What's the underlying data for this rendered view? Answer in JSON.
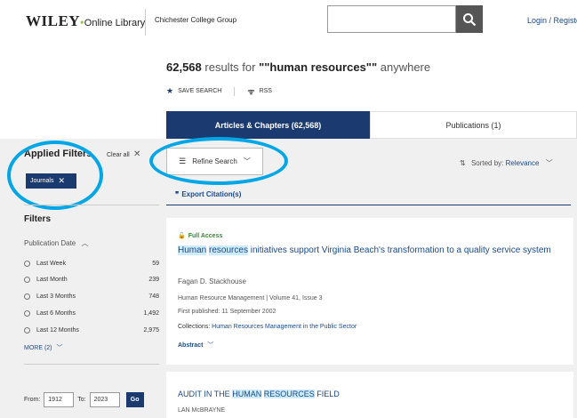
{
  "header": {
    "logo_main": "WILEY",
    "logo_sub": "Online Library",
    "institution": "Chichester College Group",
    "search_placeholder": "",
    "login": "Login / Registe"
  },
  "results": {
    "count": "62,568",
    "results_for": "results for",
    "query": "\"\"human resources\"\"",
    "scope": "anywhere",
    "save_search": "SAVE SEARCH",
    "rss": "RSS"
  },
  "tabs": [
    {
      "label": "Articles & Chapters (62,568)",
      "active": true
    },
    {
      "label": "Publications (1)",
      "active": false
    }
  ],
  "sidebar": {
    "applied_title": "Applied Filters",
    "clear_all": "Clear all",
    "chip": "Journals",
    "filters_title": "Filters",
    "pub_date": "Publication Date",
    "dates": [
      {
        "label": "Last Week",
        "count": "59"
      },
      {
        "label": "Last Month",
        "count": "239"
      },
      {
        "label": "Last 3 Months",
        "count": "748"
      },
      {
        "label": "Last 6 Months",
        "count": "1,492"
      },
      {
        "label": "Last 12 Months",
        "count": "2,975"
      }
    ],
    "more": "MORE (2)",
    "from_label": "From:",
    "from_value": "1912",
    "to_label": "To:",
    "to_value": "2023",
    "go": "Go"
  },
  "toolbar": {
    "refine": "Refine Search",
    "sorted_label": "Sorted by:",
    "sorted_value": "Relevance",
    "export": "Export Citation(s)"
  },
  "result1": {
    "access": "Full Access",
    "title_hl1": "Human",
    "title_hl2": "resources",
    "title_rest": "initiatives support Virginia Beach's transformation to a quality service system",
    "author": "Fagan D. Stackhouse",
    "journal": "Human Resource Management | Volume 41, Issue 3",
    "published": "First published: 11 September 2002",
    "collections_label": "Collections:",
    "collections_value": "Human Resources Management in the Public Sector",
    "abstract": "Abstract"
  },
  "result2": {
    "title_pre": "AUDIT IN THE",
    "title_hl1": "HUMAN",
    "title_hl2": "RESOURCES",
    "title_post": "FIELD",
    "author": "LAN McBRAYNE"
  },
  "colors": {
    "brand_navy": "#1b3a70",
    "annotation_circle": "#00a6e6",
    "access_green": "#2e8b2e"
  }
}
